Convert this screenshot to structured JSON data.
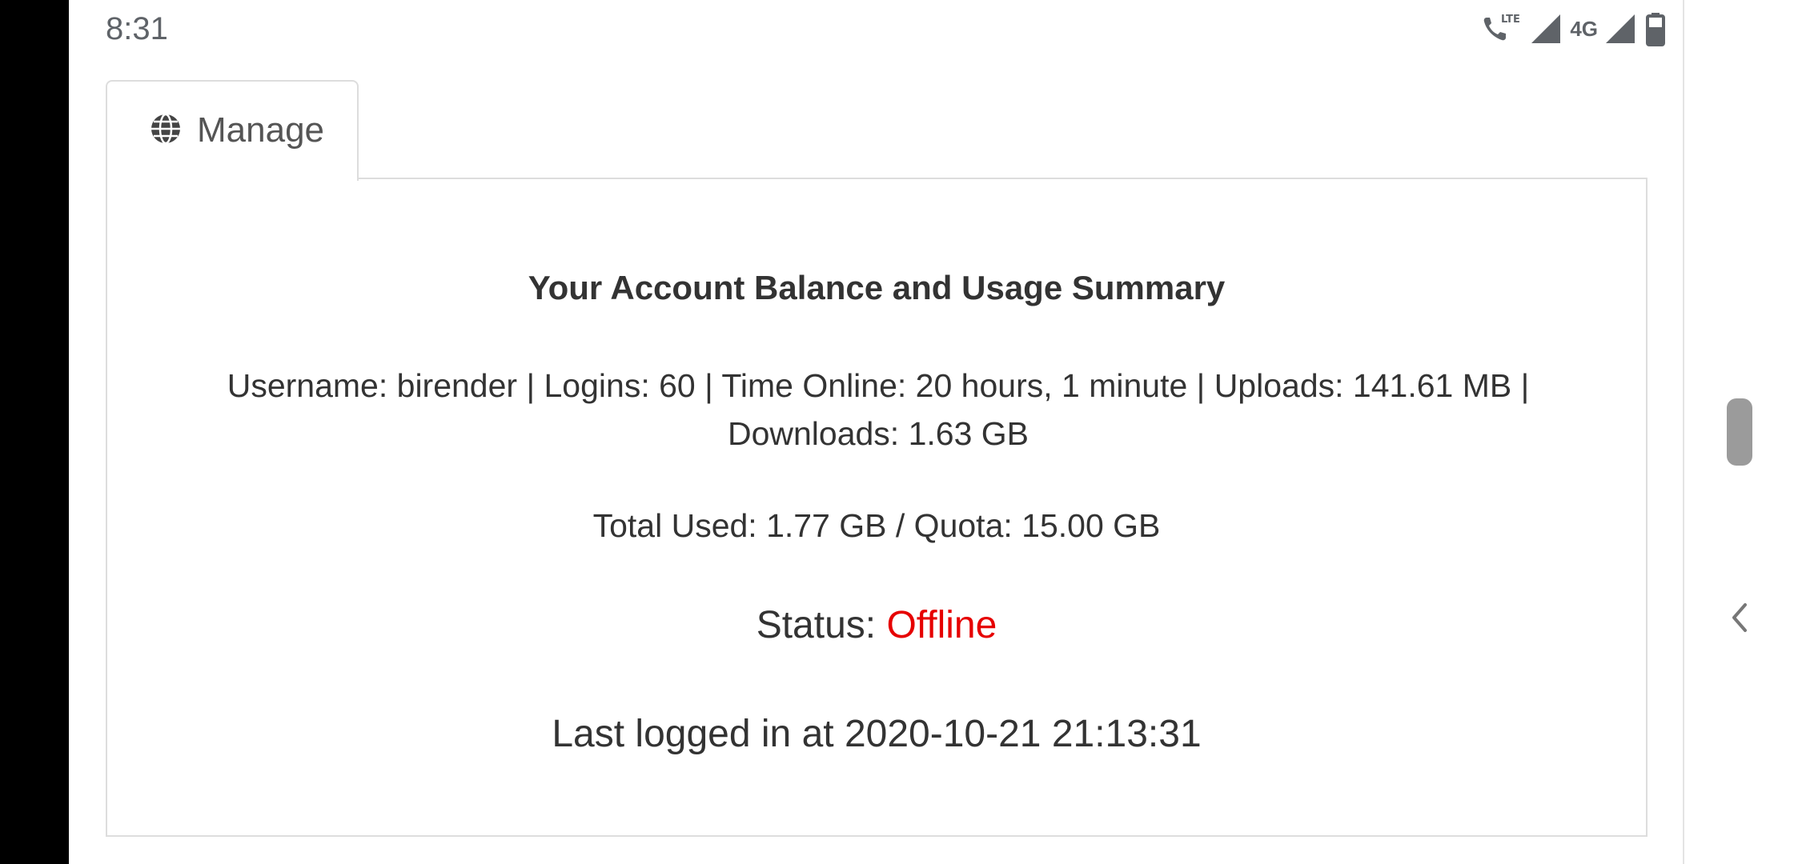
{
  "status_bar": {
    "time": "8:31",
    "network_label": "4G",
    "icons": [
      "lte-call-icon",
      "signal-icon",
      "signal-4g-icon",
      "battery-icon"
    ]
  },
  "tab": {
    "icon": "globe-icon",
    "label": "Manage"
  },
  "summary": {
    "title": "Your Account Balance and Usage Summary",
    "details": "Username: birender | Logins: 60 | Time Online: 20 hours, 1 minute | Uploads: 141.61 MB | Downloads: 1.63 GB",
    "totals": "Total Used: 1.77 GB / Quota: 15.00 GB",
    "status_label": "Status: ",
    "status_value": "Offline",
    "last_login": "Last logged in at 2020-10-21 21:13:31"
  },
  "colors": {
    "status_offline": "#e60000",
    "border": "#dddddd",
    "text": "#333333"
  }
}
